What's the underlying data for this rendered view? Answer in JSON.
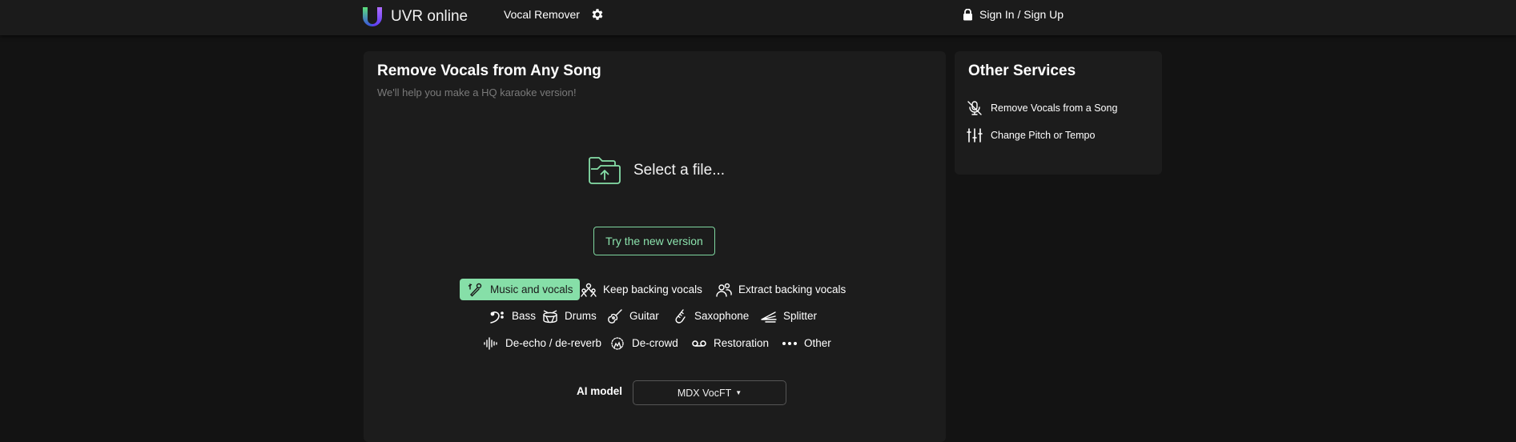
{
  "header": {
    "app_title": "UVR online",
    "nav_link": "Vocal Remover",
    "settings_icon": "gear-icon",
    "signin_label": "Sign In / Sign Up",
    "signin_icon": "lock-icon"
  },
  "main": {
    "title": "Remove Vocals from Any Song",
    "subtitle": "We'll help you make a HQ karaoke version!",
    "select_file_label": "Select a file...",
    "try_button": "Try the new version",
    "modes": [
      {
        "label": "Music and vocals",
        "icon": "music-vocals-icon",
        "active": true
      },
      {
        "label": "Keep backing vocals",
        "icon": "group-icon",
        "active": false
      },
      {
        "label": "Extract backing vocals",
        "icon": "people-icon",
        "active": false
      },
      {
        "label": "Bass",
        "icon": "bass-clef-icon",
        "active": false
      },
      {
        "label": "Drums",
        "icon": "drum-icon",
        "active": false
      },
      {
        "label": "Guitar",
        "icon": "guitar-icon",
        "active": false
      },
      {
        "label": "Saxophone",
        "icon": "saxophone-icon",
        "active": false
      },
      {
        "label": "Splitter",
        "icon": "splitter-icon",
        "active": false
      },
      {
        "label": "De-echo / de-reverb",
        "icon": "waveform-icon",
        "active": false
      },
      {
        "label": "De-crowd",
        "icon": "crowd-icon",
        "active": false
      },
      {
        "label": "Restoration",
        "icon": "tape-icon",
        "active": false
      },
      {
        "label": "Other",
        "icon": "dots-icon",
        "active": false
      }
    ],
    "ai_model_label": "AI model",
    "ai_model_value": "MDX VocFT"
  },
  "sidebar": {
    "title": "Other Services",
    "items": [
      {
        "label": "Remove Vocals from a Song",
        "icon": "mic-off-icon"
      },
      {
        "label": "Change Pitch or Tempo",
        "icon": "sliders-icon"
      }
    ]
  },
  "colors": {
    "accent": "#86dfa8",
    "background": "#131313",
    "card": "#1c1c1c",
    "header": "#1b1b1b"
  }
}
